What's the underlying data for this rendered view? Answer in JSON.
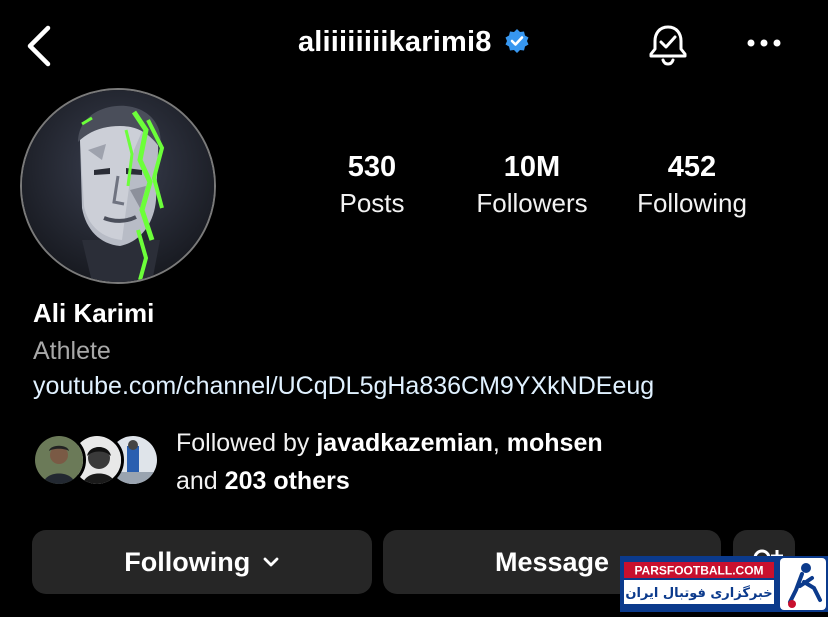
{
  "header": {
    "username": "aliiiiiiiikarimi8",
    "verified_badge_icon": "verified-check-icon",
    "back_icon": "chevron-left-icon",
    "notify_icon": "bell-check-icon",
    "more_icon": "more-horizontal-icon"
  },
  "stats": {
    "posts": {
      "value": "530",
      "label": "Posts"
    },
    "followers": {
      "value": "10M",
      "label": "Followers"
    },
    "following": {
      "value": "452",
      "label": "Following"
    }
  },
  "bio": {
    "name": "Ali Karimi",
    "category": "Athlete",
    "link": "youtube.com/channel/UCqDL5gHa836CM9YXkNDEeug"
  },
  "followed_by": {
    "prefix": "Followed by ",
    "user1": "javadkazemian",
    "sep": ", ",
    "user2": "mohsen",
    "and": "and ",
    "others": "203 others"
  },
  "actions": {
    "following_label": "Following",
    "message_label": "Message",
    "add_icon": "add-person-icon"
  },
  "watermark": {
    "site": "PARSFOOTBALL.COM",
    "tagline": "خبرگزاری فوتبال ایران"
  },
  "colors": {
    "background": "#000000",
    "button": "#262626",
    "verified": "#3797f0",
    "accent_green": "#6cff3a",
    "watermark_blue": "#0b3a8c"
  }
}
